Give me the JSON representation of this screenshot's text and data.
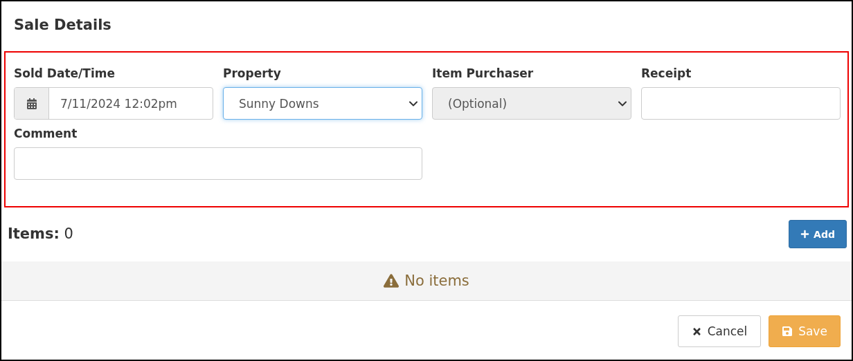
{
  "title": "Sale Details",
  "form_rows": [
    [
      {
        "label": "Sold Date/Time",
        "kind": "datetime",
        "value": "7/11/2024 12:02pm",
        "focused": false,
        "disabled": false
      },
      {
        "label": "Property",
        "kind": "select",
        "value": "Sunny Downs",
        "focused": true,
        "disabled": false
      },
      {
        "label": "Item Purchaser",
        "kind": "select",
        "placeholder": "(Optional)",
        "focused": false,
        "disabled": true
      },
      {
        "label": "Receipt",
        "kind": "text",
        "focused": false,
        "disabled": false
      }
    ],
    [
      {
        "label": "Comment",
        "kind": "wide-text",
        "focused": false,
        "disabled": false
      }
    ]
  ],
  "items": {
    "label": "Items:",
    "count": "0",
    "add_button": "Add",
    "empty_message": "No items"
  },
  "buttons": [
    {
      "label": "Cancel",
      "kind": "cancel"
    },
    {
      "label": "Save",
      "kind": "save"
    }
  ]
}
